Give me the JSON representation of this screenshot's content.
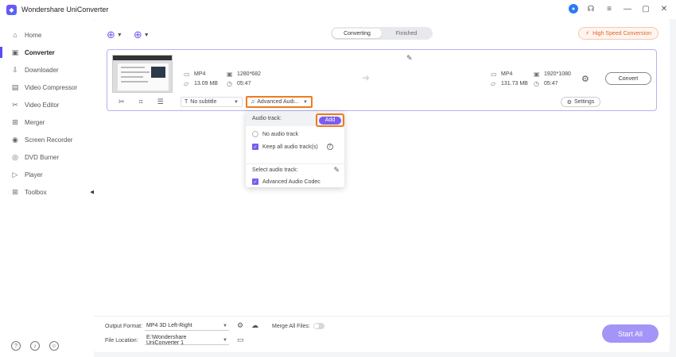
{
  "app": {
    "title": "Wondershare UniConverter",
    "logo_icon": "uniconverter-logo-icon"
  },
  "window_controls": [
    "account-icon",
    "headset-icon",
    "menu-icon",
    "minimize-icon",
    "maximize-icon",
    "close-icon"
  ],
  "sidebar": {
    "items": [
      {
        "label": "Home",
        "icon": "home-icon"
      },
      {
        "label": "Converter",
        "icon": "converter-icon",
        "active": true
      },
      {
        "label": "Downloader",
        "icon": "download-icon"
      },
      {
        "label": "Video Compressor",
        "icon": "compress-icon"
      },
      {
        "label": "Video Editor",
        "icon": "scissors-icon"
      },
      {
        "label": "Merger",
        "icon": "merge-icon"
      },
      {
        "label": "Screen Recorder",
        "icon": "record-icon"
      },
      {
        "label": "DVD Burner",
        "icon": "disc-icon"
      },
      {
        "label": "Player",
        "icon": "play-icon"
      },
      {
        "label": "Toolbox",
        "icon": "grid-icon"
      }
    ],
    "bottom_icons": [
      "help-icon",
      "bell-icon",
      "feedback-icon"
    ]
  },
  "toolbar": {
    "tabs": {
      "converting": "Converting",
      "finished": "Finished"
    },
    "high_speed": "High Speed Conversion"
  },
  "file": {
    "source": {
      "format": "MP4",
      "resolution": "1280*682",
      "size": "13.09 MB",
      "duration": "05:47"
    },
    "target": {
      "format": "MP4",
      "resolution": "1920*1080",
      "size": "131.73 MB",
      "duration": "05:47"
    },
    "convert_label": "Convert",
    "subtitle": "No subtitle",
    "audio": "Advanced Audi...",
    "settings_label": "Settings"
  },
  "audio_dropdown": {
    "header": "Audio track:",
    "add_label": "Add",
    "no_audio": "No audio track",
    "keep_all": "Keep all audio track(s)",
    "select_label": "Select audio track:",
    "codec": "Advanced Audio Codec"
  },
  "bottom": {
    "output_format_label": "Output Format:",
    "output_format_value": "MP4 3D Left-Right",
    "merge_label": "Merge All Files:",
    "file_location_label": "File Location:",
    "file_location_value": "E:\\Wondershare UniConverter 1",
    "start_all": "Start All"
  },
  "colors": {
    "accent": "#7a5cf0",
    "highlight": "#f07a1e",
    "start_button": "#a394f7"
  }
}
